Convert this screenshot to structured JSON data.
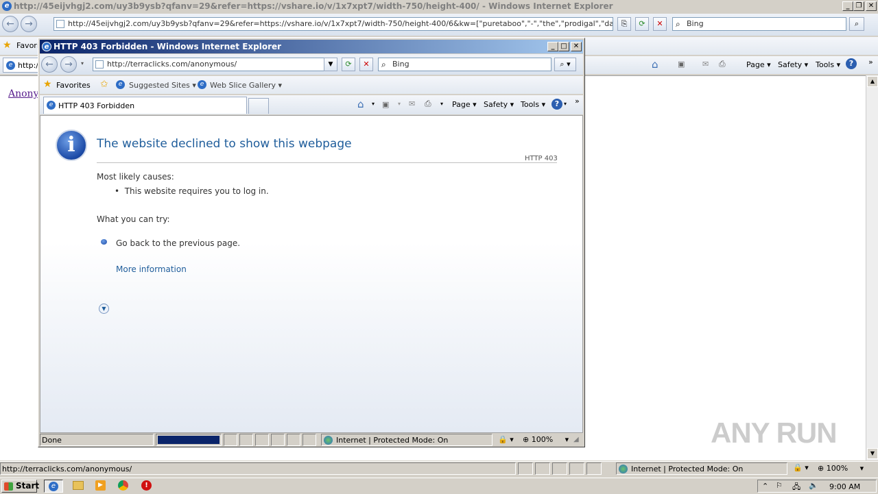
{
  "bg_window": {
    "title": "http://45eijvhgj2.com/uy3b9ysb?qfanv=29&refer=https://vshare.io/v/1x7xpt7/width-750/height-400/ - Windows Internet Explorer",
    "address": "http://45eijvhgj2.com/uy3b9ysb?qfanv=29&refer=https://vshare.io/v/1x7xpt7/width-750/height-400/6&kw=[\"puretaboo\",\"-\",\"the\",\"prodigal\",\"daughter\",\"-\",\"vs",
    "search_placeholder": "Bing",
    "favorites_label": "Favori",
    "tab_label": "http:/",
    "page_link": "Anony",
    "cmd": {
      "page": "Page",
      "safety": "Safety",
      "tools": "Tools"
    },
    "status_url": "http://terraclicks.com/anonymous/",
    "status_zone": "Internet | Protected Mode: On",
    "zoom": "100%"
  },
  "fg_window": {
    "title": "HTTP 403 Forbidden - Windows Internet Explorer",
    "address": "http://terraclicks.com/anonymous/",
    "search_placeholder": "Bing",
    "favorites_label": "Favorites",
    "suggested_sites": "Suggested Sites",
    "web_slice_gallery": "Web Slice Gallery",
    "tab_label": "HTTP 403 Forbidden",
    "cmd": {
      "page": "Page",
      "safety": "Safety",
      "tools": "Tools"
    },
    "error": {
      "heading": "The website declined to show this webpage",
      "code": "HTTP 403",
      "causes_title": "Most likely causes:",
      "cause_1": "This website requires you to log in.",
      "try_title": "What you can try:",
      "try_1": "Go back to the previous page.",
      "more_info": "More information"
    },
    "status_text": "Done",
    "status_zone": "Internet | Protected Mode: On",
    "zoom": "100%"
  },
  "taskbar": {
    "start_label": "Start",
    "clock": "9:00 AM"
  },
  "watermark": "ANY RUN",
  "colors": {
    "title_active": "#0a246a",
    "link_blue": "#1f5d9b",
    "heading_blue": "#1f5d9b",
    "progress_fill": "#0a246a"
  }
}
